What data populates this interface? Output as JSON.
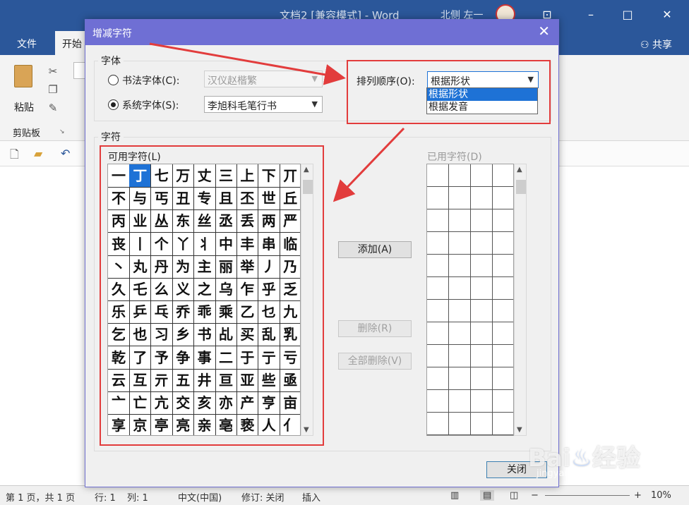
{
  "window": {
    "title": "文档2 [兼容模式] - Word",
    "user": "北侧 左一",
    "min_icon": "minimize-icon",
    "max_icon": "maximize-icon",
    "close_icon": "close-icon"
  },
  "ribbon": {
    "tabs": [
      "文件",
      "开始"
    ],
    "share": "共享",
    "paste": "粘贴",
    "clipboard_group": "剪贴板"
  },
  "dialog": {
    "title": "增减字符",
    "font_group": "字体",
    "calligraphy_radio": "书法字体(C):",
    "calligraphy_font": "汉仪赵楷繁",
    "system_radio": "系统字体(S):",
    "system_font": "李旭科毛笔行书",
    "sort_label": "排列顺序(O):",
    "sort_value": "根据形状",
    "sort_options": [
      "根据形状",
      "根据发音"
    ],
    "chars_group": "字符",
    "available_label": "可用字符(L)",
    "used_label": "已用字符(D)",
    "add_button": "添加(A)",
    "remove_button": "删除(R)",
    "remove_all_button": "全部删除(V)",
    "close_button": "关闭",
    "available_chars": [
      [
        "一",
        "丁",
        "七",
        "万",
        "丈",
        "三",
        "上",
        "下",
        "丌"
      ],
      [
        "不",
        "与",
        "丐",
        "丑",
        "专",
        "且",
        "丕",
        "世",
        "丘"
      ],
      [
        "丙",
        "业",
        "丛",
        "东",
        "丝",
        "丞",
        "丢",
        "两",
        "严"
      ],
      [
        "丧",
        "丨",
        "个",
        "丫",
        "丬",
        "中",
        "丰",
        "串",
        "临"
      ],
      [
        "丶",
        "丸",
        "丹",
        "为",
        "主",
        "丽",
        "举",
        "丿",
        "乃"
      ],
      [
        "久",
        "乇",
        "么",
        "义",
        "之",
        "乌",
        "乍",
        "乎",
        "乏"
      ],
      [
        "乐",
        "乒",
        "乓",
        "乔",
        "乖",
        "乘",
        "乙",
        "乜",
        "九"
      ],
      [
        "乞",
        "也",
        "习",
        "乡",
        "书",
        "乩",
        "买",
        "乱",
        "乳"
      ],
      [
        "乾",
        "了",
        "予",
        "争",
        "事",
        "二",
        "于",
        "亍",
        "亏"
      ],
      [
        "云",
        "互",
        "亓",
        "五",
        "井",
        "亘",
        "亚",
        "些",
        "亟"
      ],
      [
        "亠",
        "亡",
        "亢",
        "交",
        "亥",
        "亦",
        "产",
        "亨",
        "亩"
      ],
      [
        "享",
        "京",
        "亭",
        "亮",
        "亲",
        "亳",
        "亵",
        "人",
        "亻"
      ]
    ],
    "selected_char": "丁"
  },
  "status": {
    "page": "第 1 页，共 1 页",
    "line": "行: 1",
    "col": "列: 1",
    "lang": "中文(中国)",
    "track": "修订: 关闭",
    "mode": "插入",
    "zoom": "10%"
  },
  "watermark": {
    "main": "Bai 经验",
    "sub": "jingyan.baidu.com"
  }
}
